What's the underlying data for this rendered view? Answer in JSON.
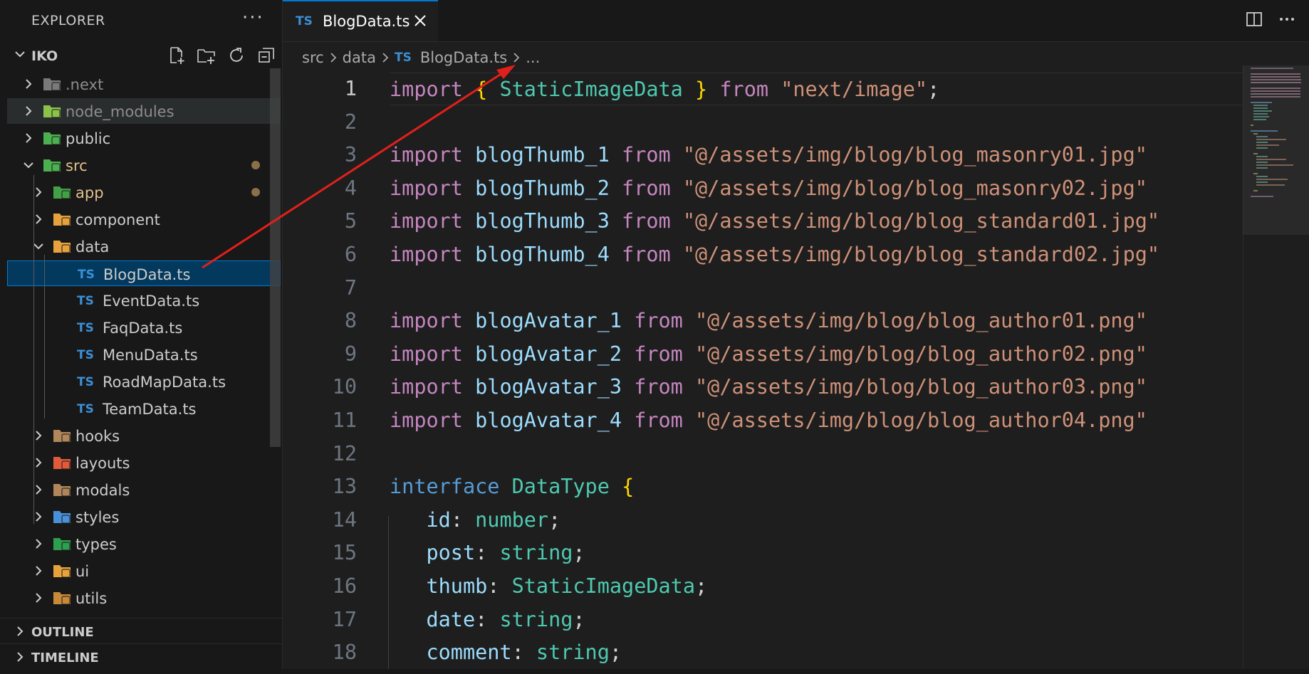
{
  "sidebar": {
    "title": "EXPLORER",
    "more": "···",
    "project": "IKO",
    "tree": [
      {
        "label": ".next",
        "icon": "next-folder-icon",
        "kind": "folder",
        "level": 0,
        "style": "dim"
      },
      {
        "label": "node_modules",
        "icon": "node-folder-icon",
        "kind": "folder",
        "level": 0,
        "style": "dim"
      },
      {
        "label": "public",
        "icon": "public-folder-icon",
        "kind": "folder",
        "level": 0,
        "style": "normal"
      },
      {
        "label": "src",
        "icon": "src-folder-icon",
        "kind": "folder-open",
        "level": 0,
        "style": "mod"
      },
      {
        "label": "app",
        "icon": "app-folder-icon",
        "kind": "folder",
        "level": 1,
        "style": "mod"
      },
      {
        "label": "component",
        "icon": "component-folder-icon",
        "kind": "folder",
        "level": 1,
        "style": "normal"
      },
      {
        "label": "data",
        "icon": "data-folder-icon",
        "kind": "folder-open",
        "level": 1,
        "style": "normal"
      },
      {
        "label": "BlogData.ts",
        "icon": "ts-file-icon",
        "kind": "file",
        "level": 2,
        "style": "normal"
      },
      {
        "label": "EventData.ts",
        "icon": "ts-file-icon",
        "kind": "file",
        "level": 2,
        "style": "normal"
      },
      {
        "label": "FaqData.ts",
        "icon": "ts-file-icon",
        "kind": "file",
        "level": 2,
        "style": "normal"
      },
      {
        "label": "MenuData.ts",
        "icon": "ts-file-icon",
        "kind": "file",
        "level": 2,
        "style": "normal"
      },
      {
        "label": "RoadMapData.ts",
        "icon": "ts-file-icon",
        "kind": "file",
        "level": 2,
        "style": "normal"
      },
      {
        "label": "TeamData.ts",
        "icon": "ts-file-icon",
        "kind": "file",
        "level": 2,
        "style": "normal"
      },
      {
        "label": "hooks",
        "icon": "hooks-folder-icon",
        "kind": "folder",
        "level": 1,
        "style": "normal"
      },
      {
        "label": "layouts",
        "icon": "layouts-folder-icon",
        "kind": "folder",
        "level": 1,
        "style": "normal"
      },
      {
        "label": "modals",
        "icon": "modals-folder-icon",
        "kind": "folder",
        "level": 1,
        "style": "normal"
      },
      {
        "label": "styles",
        "icon": "styles-folder-icon",
        "kind": "folder",
        "level": 1,
        "style": "normal"
      },
      {
        "label": "types",
        "icon": "types-folder-icon",
        "kind": "folder",
        "level": 1,
        "style": "normal"
      },
      {
        "label": "ui",
        "icon": "ui-folder-icon",
        "kind": "folder",
        "level": 1,
        "style": "normal"
      },
      {
        "label": "utils",
        "icon": "utils-folder-icon",
        "kind": "folder",
        "level": 1,
        "style": "normal"
      }
    ],
    "ts_badge": "TS",
    "sections": [
      "OUTLINE",
      "TIMELINE"
    ]
  },
  "editor": {
    "tab": {
      "badge": "TS",
      "name": "BlogData.ts"
    },
    "breadcrumb": {
      "parts": [
        "src",
        "data"
      ],
      "file": "BlogData.ts",
      "badge": "TS",
      "more": "..."
    },
    "lines": [
      [
        [
          "kw",
          "import"
        ],
        [
          "pn",
          " "
        ],
        [
          "br",
          "{"
        ],
        [
          "pn",
          " "
        ],
        [
          "ty",
          "StaticImageData"
        ],
        [
          "pn",
          " "
        ],
        [
          "br",
          "}"
        ],
        [
          "pn",
          " "
        ],
        [
          "kw",
          "from"
        ],
        [
          "pn",
          " "
        ],
        [
          "st",
          "\"next/image\""
        ],
        [
          "pn",
          ";"
        ]
      ],
      [],
      [
        [
          "kw",
          "import"
        ],
        [
          "pn",
          " "
        ],
        [
          "id",
          "blogThumb_1"
        ],
        [
          "pn",
          " "
        ],
        [
          "kw",
          "from"
        ],
        [
          "pn",
          " "
        ],
        [
          "st",
          "\"@/assets/img/blog/blog_masonry01.jpg\""
        ]
      ],
      [
        [
          "kw",
          "import"
        ],
        [
          "pn",
          " "
        ],
        [
          "id",
          "blogThumb_2"
        ],
        [
          "pn",
          " "
        ],
        [
          "kw",
          "from"
        ],
        [
          "pn",
          " "
        ],
        [
          "st",
          "\"@/assets/img/blog/blog_masonry02.jpg\""
        ]
      ],
      [
        [
          "kw",
          "import"
        ],
        [
          "pn",
          " "
        ],
        [
          "id",
          "blogThumb_3"
        ],
        [
          "pn",
          " "
        ],
        [
          "kw",
          "from"
        ],
        [
          "pn",
          " "
        ],
        [
          "st",
          "\"@/assets/img/blog/blog_standard01.jpg\""
        ]
      ],
      [
        [
          "kw",
          "import"
        ],
        [
          "pn",
          " "
        ],
        [
          "id",
          "blogThumb_4"
        ],
        [
          "pn",
          " "
        ],
        [
          "kw",
          "from"
        ],
        [
          "pn",
          " "
        ],
        [
          "st",
          "\"@/assets/img/blog/blog_standard02.jpg\""
        ]
      ],
      [],
      [
        [
          "kw",
          "import"
        ],
        [
          "pn",
          " "
        ],
        [
          "id",
          "blogAvatar_1"
        ],
        [
          "pn",
          " "
        ],
        [
          "kw",
          "from"
        ],
        [
          "pn",
          " "
        ],
        [
          "st",
          "\"@/assets/img/blog/blog_author01.png\""
        ]
      ],
      [
        [
          "kw",
          "import"
        ],
        [
          "pn",
          " "
        ],
        [
          "id",
          "blogAvatar_2"
        ],
        [
          "pn",
          " "
        ],
        [
          "kw",
          "from"
        ],
        [
          "pn",
          " "
        ],
        [
          "st",
          "\"@/assets/img/blog/blog_author02.png\""
        ]
      ],
      [
        [
          "kw",
          "import"
        ],
        [
          "pn",
          " "
        ],
        [
          "id",
          "blogAvatar_3"
        ],
        [
          "pn",
          " "
        ],
        [
          "kw",
          "from"
        ],
        [
          "pn",
          " "
        ],
        [
          "st",
          "\"@/assets/img/blog/blog_author03.png\""
        ]
      ],
      [
        [
          "kw",
          "import"
        ],
        [
          "pn",
          " "
        ],
        [
          "id",
          "blogAvatar_4"
        ],
        [
          "pn",
          " "
        ],
        [
          "kw",
          "from"
        ],
        [
          "pn",
          " "
        ],
        [
          "st",
          "\"@/assets/img/blog/blog_author04.png\""
        ]
      ],
      [],
      [
        [
          "kw2",
          "interface"
        ],
        [
          "pn",
          " "
        ],
        [
          "ty",
          "DataType"
        ],
        [
          "pn",
          " "
        ],
        [
          "br",
          "{"
        ]
      ],
      [
        [
          "pn",
          "   "
        ],
        [
          "id",
          "id"
        ],
        [
          "pn",
          ": "
        ],
        [
          "ty",
          "number"
        ],
        [
          "pn",
          ";"
        ]
      ],
      [
        [
          "pn",
          "   "
        ],
        [
          "id",
          "post"
        ],
        [
          "pn",
          ": "
        ],
        [
          "ty",
          "string"
        ],
        [
          "pn",
          ";"
        ]
      ],
      [
        [
          "pn",
          "   "
        ],
        [
          "id",
          "thumb"
        ],
        [
          "pn",
          ": "
        ],
        [
          "ty",
          "StaticImageData"
        ],
        [
          "pn",
          ";"
        ]
      ],
      [
        [
          "pn",
          "   "
        ],
        [
          "id",
          "date"
        ],
        [
          "pn",
          ": "
        ],
        [
          "ty",
          "string"
        ],
        [
          "pn",
          ";"
        ]
      ],
      [
        [
          "pn",
          "   "
        ],
        [
          "id",
          "comment"
        ],
        [
          "pn",
          ": "
        ],
        [
          "ty",
          "string"
        ],
        [
          "pn",
          ";"
        ]
      ]
    ],
    "line_numbers": [
      "1",
      "2",
      "3",
      "4",
      "5",
      "6",
      "7",
      "8",
      "9",
      "10",
      "11",
      "12",
      "13",
      "14",
      "15",
      "16",
      "17",
      "18"
    ],
    "current_line": 1,
    "annotation_color": "#e0201b"
  }
}
